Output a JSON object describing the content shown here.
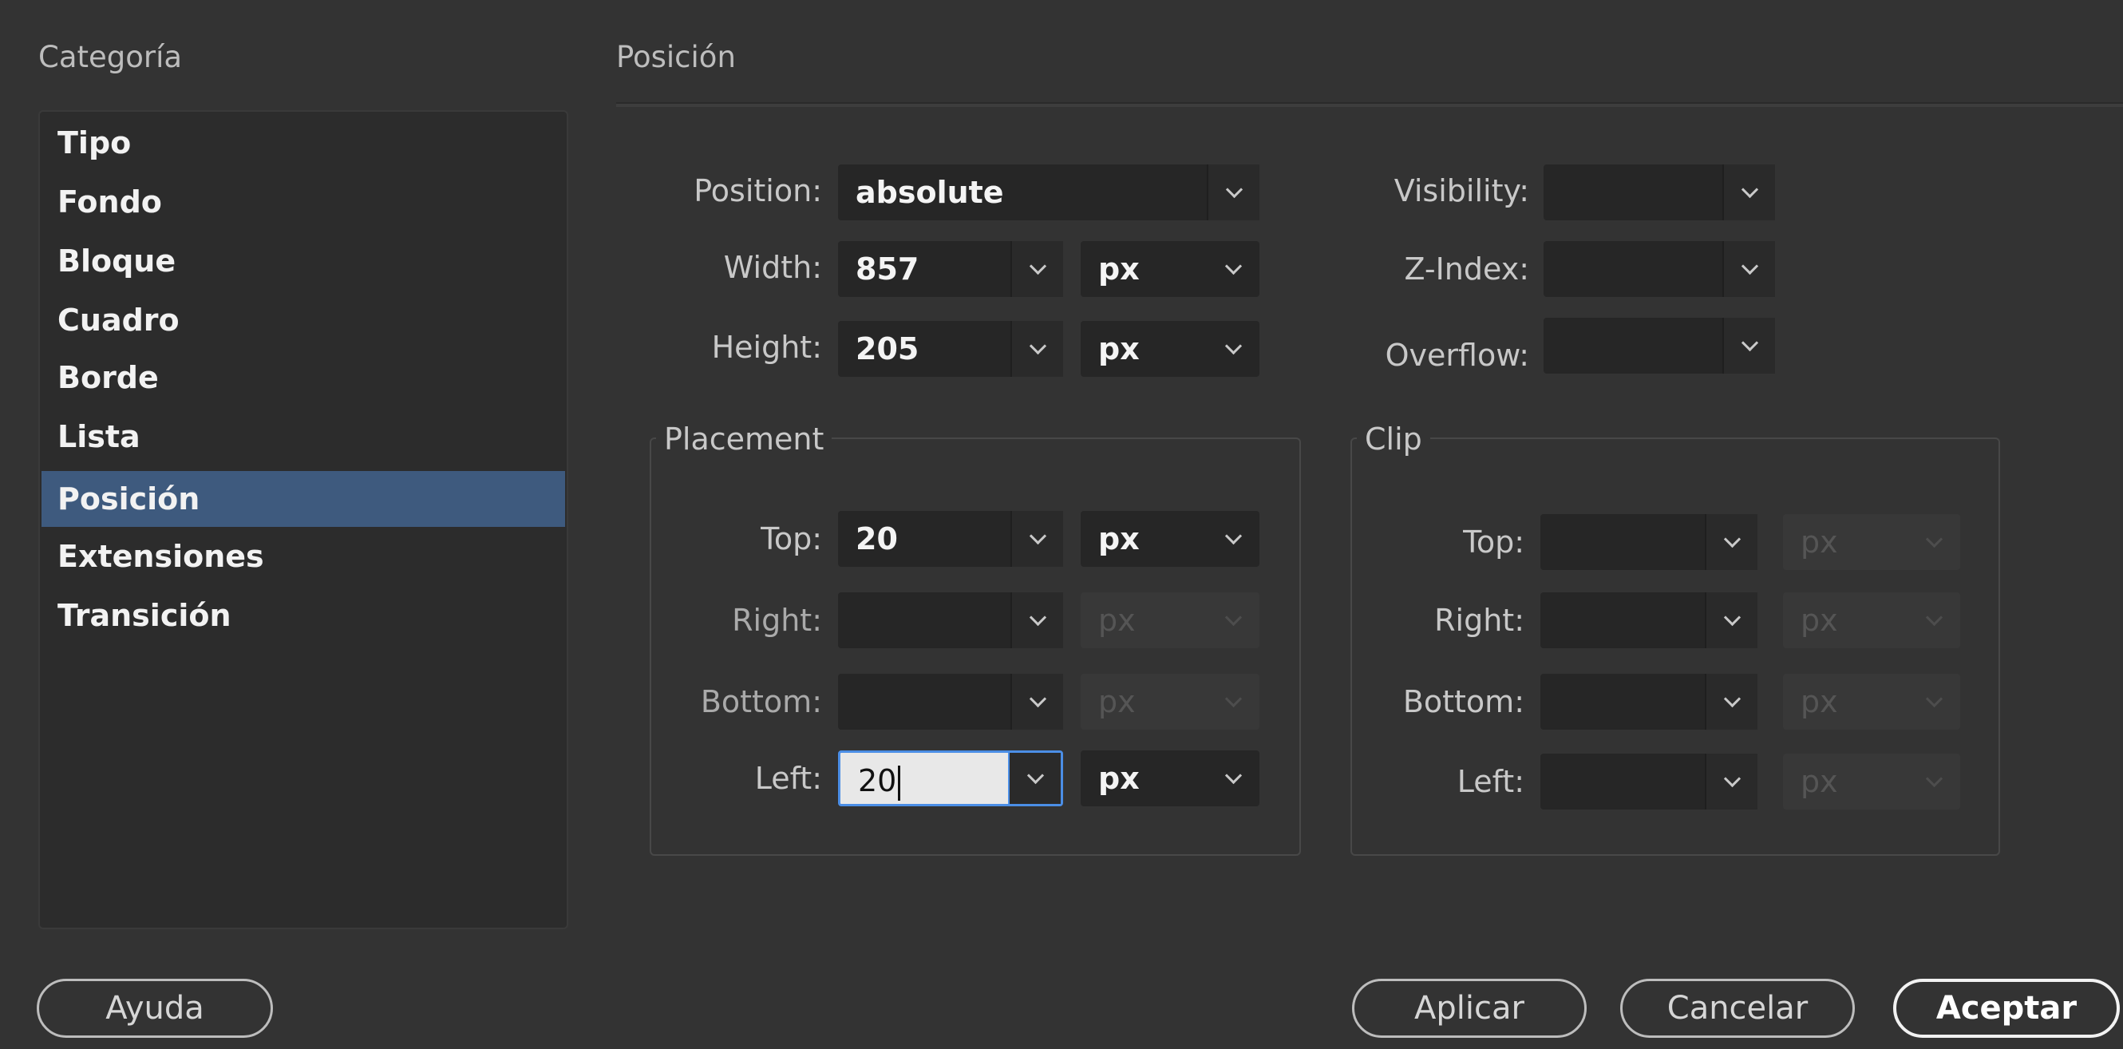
{
  "header": {
    "category_title": "Categoría",
    "section_title": "Posición"
  },
  "sidebar": {
    "items": [
      {
        "label": "Tipo"
      },
      {
        "label": "Fondo"
      },
      {
        "label": "Bloque"
      },
      {
        "label": "Cuadro"
      },
      {
        "label": "Borde"
      },
      {
        "label": "Lista"
      },
      {
        "label": "Posición",
        "selected": true
      },
      {
        "label": "Extensiones"
      },
      {
        "label": "Transición"
      }
    ]
  },
  "position": {
    "position_label": "Position:",
    "position_value": "absolute",
    "width_label": "Width:",
    "width_value": "857",
    "width_unit": "px",
    "height_label": "Height:",
    "height_value": "205",
    "height_unit": "px",
    "visibility_label": "Visibility:",
    "visibility_value": "",
    "zindex_label": "Z-Index:",
    "zindex_value": "",
    "overflow_label": "Overflow:",
    "overflow_value": ""
  },
  "placement": {
    "title": "Placement",
    "top_label": "Top:",
    "top_value": "20",
    "top_unit": "px",
    "right_label": "Right:",
    "right_value": "",
    "right_unit": "px",
    "bottom_label": "Bottom:",
    "bottom_value": "",
    "bottom_unit": "px",
    "left_label": "Left:",
    "left_value": "20",
    "left_unit": "px"
  },
  "clip": {
    "title": "Clip",
    "top_label": "Top:",
    "top_value": "",
    "top_unit": "px",
    "right_label": "Right:",
    "right_value": "",
    "right_unit": "px",
    "bottom_label": "Bottom:",
    "bottom_value": "",
    "bottom_unit": "px",
    "left_label": "Left:",
    "left_value": "",
    "left_unit": "px"
  },
  "buttons": {
    "help": "Ayuda",
    "apply": "Aplicar",
    "cancel": "Cancelar",
    "ok": "Aceptar"
  },
  "colors": {
    "background": "#333333",
    "selection": "#3e5a7e",
    "focus": "#4b8ee6"
  }
}
